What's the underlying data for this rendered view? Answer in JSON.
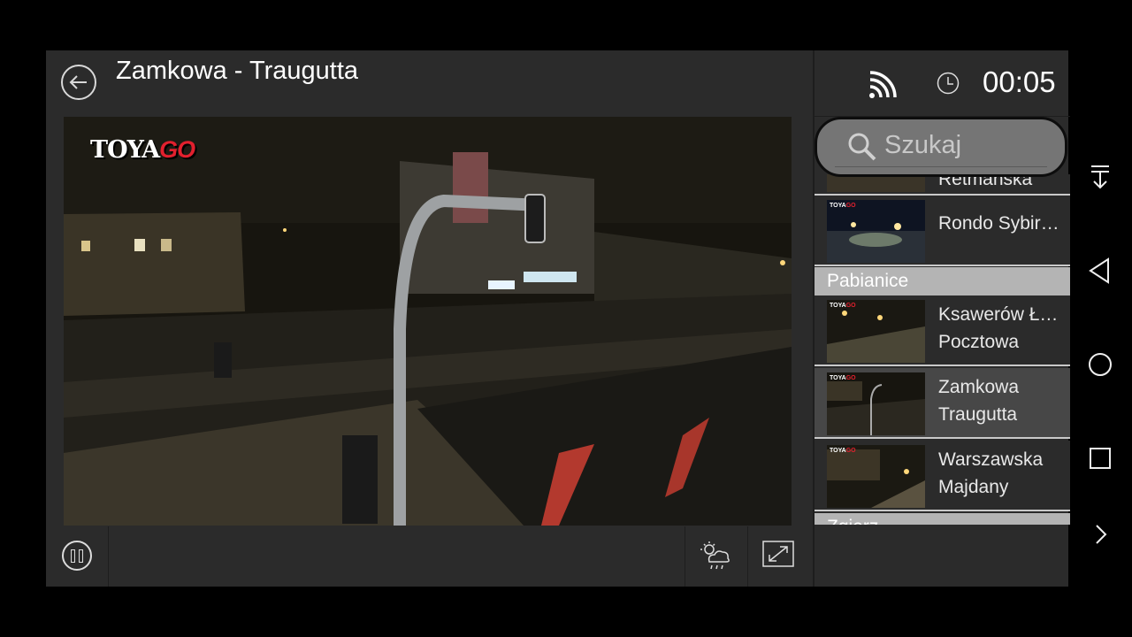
{
  "header": {
    "title": "Zamkowa - Traugutta",
    "timer": "00:05"
  },
  "video": {
    "logo_text": "TOYA",
    "logo_accent": "GO"
  },
  "search": {
    "placeholder": "Szukaj"
  },
  "camera_list": {
    "partial_top_item": "Retmańska",
    "items": [
      {
        "line1": "Rondo Sybiraków",
        "line2": "",
        "active": false
      },
      {
        "line1": "Ksawerów Łódzka",
        "line2": "Pocztowa",
        "active": false
      },
      {
        "line1": "Zamkowa",
        "line2": "Traugutta",
        "active": true
      },
      {
        "line1": "Warszawska",
        "line2": "Majdany",
        "active": false
      }
    ],
    "sections": [
      "Pabianice",
      "Zgierz"
    ],
    "thumb_logo": "TOYA",
    "thumb_logo_accent": "GO"
  },
  "colors": {
    "accent_red": "#e2202e",
    "section_bg": "#b4b4b4",
    "panel_bg": "#2b2b2b"
  },
  "icons": [
    "back-arrow-icon",
    "cast-icon",
    "clock-icon",
    "search-icon",
    "pause-icon",
    "weather-icon",
    "expand-icon",
    "nav-down-icon",
    "nav-back-icon",
    "nav-home-icon",
    "nav-recents-icon",
    "nav-more-icon"
  ]
}
